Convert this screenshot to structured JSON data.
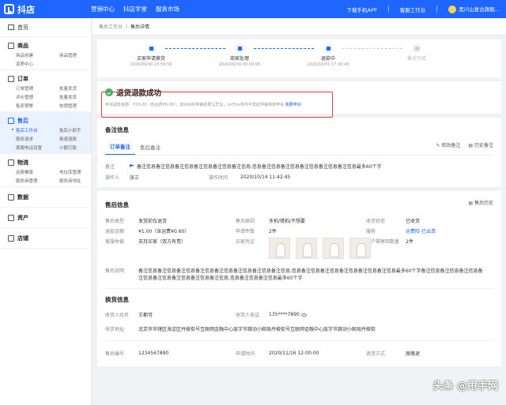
{
  "app": {
    "logo": "抖店"
  },
  "topnav": [
    "营销中心",
    "抖店学堂",
    "服务市场"
  ],
  "topright": {
    "download": "下载手机APP",
    "workbench": "客服工作台",
    "shop": "黑川山复古旗舰..."
  },
  "sidebar": {
    "home": "首页",
    "groups": [
      {
        "title": "商品",
        "items": [
          "商品创建",
          "商品管理",
          "资质中心"
        ]
      },
      {
        "title": "订单",
        "items": [
          "订单管理",
          "批量发货",
          "评价管理",
          "批量发货",
          "售卖预警",
          "核销管理"
        ]
      },
      {
        "title": "售后",
        "items": [
          "售后工作台",
          "售后小助手",
          "服务请求",
          "极速退款",
          "客服电话设置",
          "小额打款"
        ]
      },
      {
        "title": "物流",
        "items": [
          "运费模版",
          "地址库管理",
          "服务商管理",
          "服务商地址"
        ]
      },
      {
        "title": "数据",
        "items": []
      },
      {
        "title": "资产",
        "items": []
      },
      {
        "title": "店铺",
        "items": []
      }
    ]
  },
  "breadcrumb": {
    "parent": "售后工作台",
    "sep": "/",
    "current": "售后详情"
  },
  "steps": [
    {
      "name": "买家申请换货",
      "time": "2020/09/30 23:59:59"
    },
    {
      "name": "商家处理",
      "time": "2020/09/30 00:00:00"
    },
    {
      "name": "退款中",
      "time": "2020/10/01 17:30:43"
    },
    {
      "name": "售后完成",
      "time": ""
    }
  ],
  "status": {
    "title": "退货退款成功",
    "desc_prefix": "申请退款金额：",
    "amount": "¥19.00（含运费¥0.00），",
    "desc_mid": "如对纠纷仲裁结果又异议，xx天xx秒内可发起仲裁维权申诉",
    "link": "我要申诉"
  },
  "remarks": {
    "title": "备注信息",
    "tabs": [
      "订单备注",
      "售后备注"
    ],
    "actions": [
      "修改备注",
      "历史备注"
    ],
    "remark_label": "备注",
    "remark_value": "备注信息备注信息备注信息备注信息备注信息备注信息,信息备注信息备注信息备注信息备注信息备注信息最多60个字",
    "operator_label": "操作人",
    "operator_value": "张三",
    "time_label": "操作时间",
    "time_value": "2020/10/14  11:42:45"
  },
  "aftersale": {
    "title": "售后信息",
    "history": "售后历史",
    "type_label": "售后类型",
    "type_value": "发货前仅退货",
    "reason_label": "售后原因",
    "reason_value": "多拍/错拍/不想要",
    "recv_label": "收货状态",
    "recv_value": "已收货",
    "amount_label": "退款金额",
    "amount_value": "¥1.00（含运费¥0.60）",
    "qty_label": "申请件数",
    "qty_value": "2件",
    "service_label": "服务",
    "service_value": "运费险-已出单",
    "arb_label": "客服仲裁",
    "arb_value": "支持买家（双方有责）",
    "proof_label": "买家凭证",
    "return_label": "用户需寄回数量",
    "return_value": "2件",
    "desc_label": "售后说明",
    "desc_value": "备注信息备注信息备注信息备注信息备注信息备注信息备注信息备注信息,信息备注信息备注信息备注信息备注信息备注信息最多60个字备注信息备注信息备注信息备注信息备注信息备注信息备注信息备注信息,信息备注信息备注信息最多60个字"
  },
  "exchange": {
    "title": "换货信息",
    "name_label": "收货人姓名",
    "name_value": "王都可",
    "phone_label": "收货人电话",
    "phone_value": "135****7890",
    "addr_label": "收货地址",
    "addr_value": "北京市市辖区海淀区丹棱街号互联网金融中心层字节跳动小邮局丹棱街号互联网金融中心层字节跳动小邮局丹棱街",
    "no_label": "售后编号",
    "no_value": "1234567890",
    "apply_label": "申请时间",
    "apply_value": "2020/11/16  12:00:00",
    "method_label": "退货方式",
    "method_value": "原路退"
  },
  "watermark": "头条 @甩手网"
}
